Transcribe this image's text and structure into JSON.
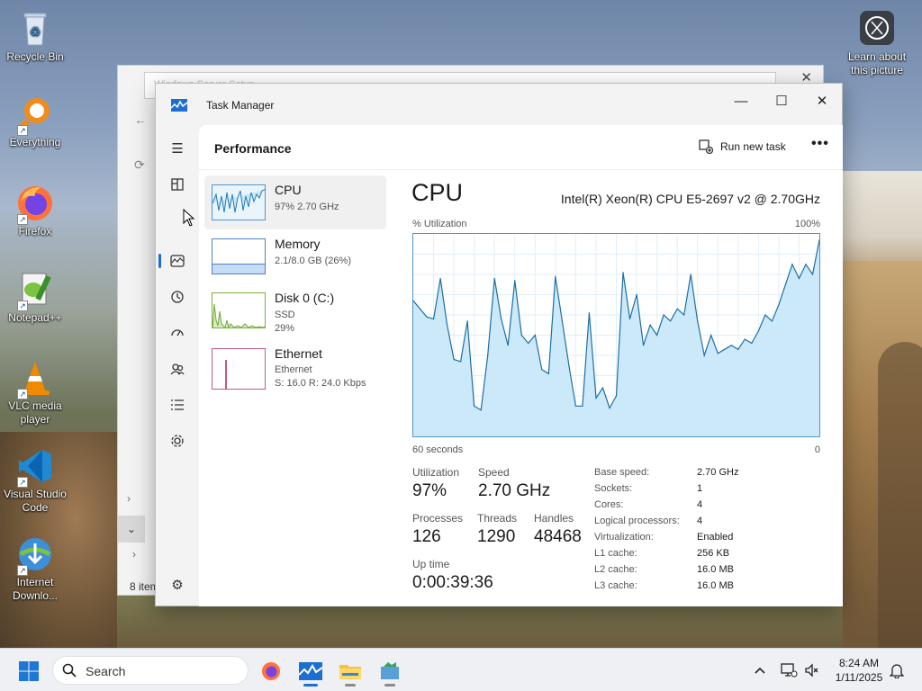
{
  "desktop": {
    "icons": [
      {
        "label": "Recycle Bin"
      },
      {
        "label": "Everything"
      },
      {
        "label": "Firefox"
      },
      {
        "label": "Notepad++"
      },
      {
        "label": "VLC media player"
      },
      {
        "label": "Visual Studio Code"
      },
      {
        "label": "Internet Downlo..."
      }
    ],
    "learn_label": "Learn about this picture"
  },
  "bg_window": {
    "title": "Windows Server Setup",
    "status": "8 item"
  },
  "task_manager": {
    "title": "Task Manager",
    "window_controls": {
      "minimize": "—",
      "maximize": "☐",
      "close": "✕"
    },
    "page_title": "Performance",
    "run_new_task": "Run new task",
    "more": "•••",
    "resources": [
      {
        "name": "CPU",
        "sub1": "97%  2.70 GHz",
        "sub2": ""
      },
      {
        "name": "Memory",
        "sub1": "2.1/8.0 GB (26%)",
        "sub2": ""
      },
      {
        "name": "Disk 0 (C:)",
        "sub1": "SSD",
        "sub2": "29%"
      },
      {
        "name": "Ethernet",
        "sub1": "Ethernet",
        "sub2": "S: 16.0  R: 24.0 Kbps"
      }
    ],
    "detail": {
      "heading": "CPU",
      "model": "Intel(R) Xeon(R) CPU E5-2697 v2 @ 2.70GHz",
      "y_label": "% Utilization",
      "y_max": "100%",
      "x_left": "60 seconds",
      "x_right": "0"
    },
    "stats": {
      "utilization_label": "Utilization",
      "utilization": "97%",
      "speed_label": "Speed",
      "speed": "2.70 GHz",
      "processes_label": "Processes",
      "processes": "126",
      "threads_label": "Threads",
      "threads": "1290",
      "handles_label": "Handles",
      "handles": "48468",
      "uptime_label": "Up time",
      "uptime": "0:00:39:36"
    },
    "specs": [
      {
        "k": "Base speed:",
        "v": "2.70 GHz"
      },
      {
        "k": "Sockets:",
        "v": "1"
      },
      {
        "k": "Cores:",
        "v": "4"
      },
      {
        "k": "Logical processors:",
        "v": "4"
      },
      {
        "k": "Virtualization:",
        "v": "Enabled"
      },
      {
        "k": "L1 cache:",
        "v": "256 KB"
      },
      {
        "k": "L2 cache:",
        "v": "16.0 MB"
      },
      {
        "k": "L3 cache:",
        "v": "16.0 MB"
      }
    ]
  },
  "chart_data": {
    "type": "area",
    "x": [
      60,
      59,
      58,
      57,
      56,
      55,
      54,
      53,
      52,
      51,
      50,
      49,
      48,
      47,
      46,
      45,
      44,
      43,
      42,
      41,
      40,
      39,
      38,
      37,
      36,
      35,
      34,
      33,
      32,
      31,
      30,
      29,
      28,
      27,
      26,
      25,
      24,
      23,
      22,
      21,
      20,
      19,
      18,
      17,
      16,
      15,
      14,
      13,
      12,
      11,
      10,
      9,
      8,
      7,
      6,
      5,
      4,
      3,
      2,
      1,
      0
    ],
    "values": [
      67,
      63,
      59,
      58,
      78,
      55,
      38,
      37,
      57,
      15,
      13,
      40,
      78,
      58,
      45,
      77,
      50,
      46,
      50,
      33,
      31,
      79,
      57,
      35,
      15,
      15,
      61,
      19,
      24,
      14,
      20,
      81,
      58,
      70,
      45,
      55,
      50,
      60,
      57,
      63,
      60,
      80,
      57,
      40,
      50,
      41,
      43,
      45,
      43,
      48,
      46,
      52,
      60,
      57,
      65,
      75,
      85,
      78,
      85,
      80,
      97
    ],
    "ylabel": "% Utilization",
    "ylim": [
      0,
      100
    ],
    "xlabel_left": "60 seconds",
    "xlabel_right": "0",
    "grid": true
  },
  "taskbar": {
    "search_placeholder": "Search",
    "time": "8:24 AM",
    "date": "1/11/2025"
  }
}
